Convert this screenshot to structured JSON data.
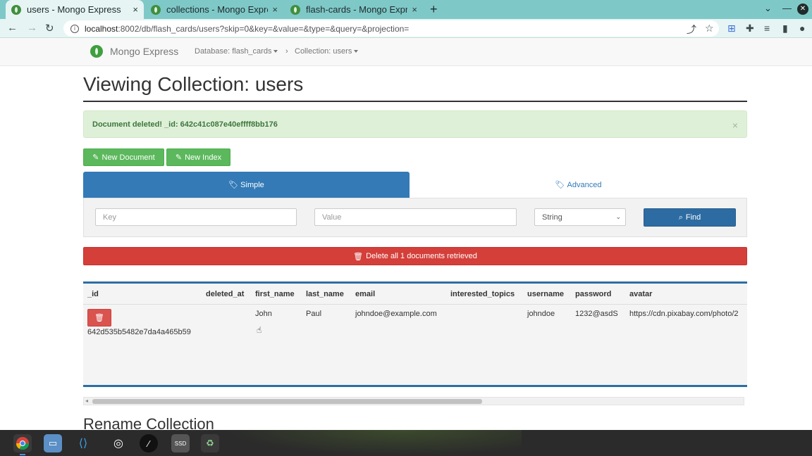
{
  "browser": {
    "tabs": [
      {
        "title": "users - Mongo Express",
        "active": true
      },
      {
        "title": "collections - Mongo Expre",
        "active": false
      },
      {
        "title": "flash-cards - Mongo Expre",
        "active": false
      }
    ],
    "new_tab": "+",
    "close_glyph": "×",
    "url": "localhost:8002/db/flash_cards/users?skip=0&key=&value=&type=&query=&projection=",
    "url_host": "localhost",
    "url_rest": ":8002/db/flash_cards/users?skip=0&key=&value=&type=&query=&projection=",
    "accent_color": "#7fc8c8"
  },
  "navbar": {
    "brand": "Mongo Express",
    "database_crumb": "Database: flash_cards",
    "collection_crumb": "Collection: users"
  },
  "page": {
    "title": "Viewing Collection: users",
    "alert": "Document deleted! _id: 642c41c087e40effff8bb176",
    "alert_close": "×",
    "new_document_label": "New Document",
    "new_index_label": "New Index",
    "tab_simple": "Simple",
    "tab_advanced": "Advanced",
    "key_placeholder": "Key",
    "value_placeholder": "Value",
    "type_selected": "String",
    "find_label": "Find",
    "delete_all_label": "Delete all 1 documents retrieved",
    "rename_heading": "Rename Collection"
  },
  "table": {
    "columns": [
      "_id",
      "deleted_at",
      "first_name",
      "last_name",
      "email",
      "interested_topics",
      "username",
      "password",
      "avatar"
    ],
    "rows": [
      {
        "_id": "642d535b5482e7da4a465b59",
        "deleted_at": "",
        "first_name": "John",
        "last_name": "Paul",
        "email": "johndoe@example.com",
        "interested_topics": "",
        "username": "johndoe",
        "password": "1232@asdS",
        "avatar": "https://cdn.pixabay.com/photo/2"
      }
    ]
  },
  "colors": {
    "primary": "#337ab7",
    "success": "#5cb85c",
    "danger": "#d9534f",
    "alert_bg": "#dff0d8"
  }
}
